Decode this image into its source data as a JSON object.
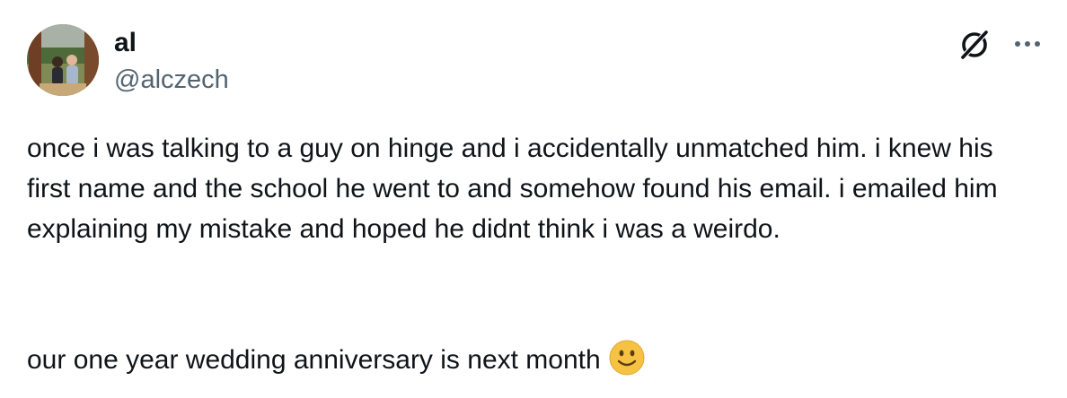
{
  "author": {
    "display_name": "al",
    "handle": "@alczech"
  },
  "icons": {
    "grok": "grok-slash-circle-icon",
    "more": "more-horizontal-icon",
    "emoji": "slightly-smiling-face-emoji"
  },
  "tweet": {
    "paragraph_1": "once i was talking to a guy on hinge and i accidentally unmatched him. i knew his first name and the school he went to and somehow found his email. i emailed him explaining my mistake and hoped he didnt think i was a weirdo.",
    "paragraph_2": "our one year wedding anniversary is next month"
  },
  "colors": {
    "text": "#0f1419",
    "secondary": "#536471",
    "emoji_face": "#f6c244"
  }
}
